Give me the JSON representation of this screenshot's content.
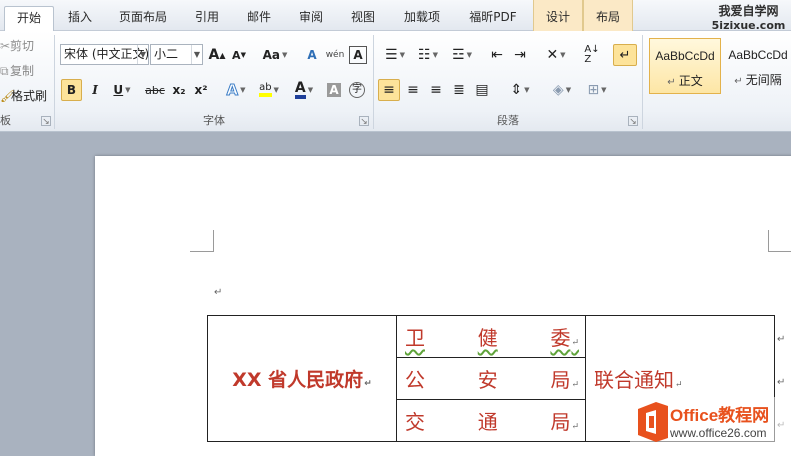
{
  "tabs": [
    "开始",
    "插入",
    "页面布局",
    "引用",
    "邮件",
    "审阅",
    "视图",
    "加载项",
    "福昕PDF",
    "设计",
    "布局"
  ],
  "active_tab": "开始",
  "brand": {
    "line1": "我爱自学网",
    "line2": "5izixue.com"
  },
  "clipboard": {
    "cut": "剪切",
    "copy": "复制",
    "format_painter": "格式刷",
    "label": "板"
  },
  "font": {
    "name": "宋体 (中文正文)",
    "size": "小二",
    "label": "字体",
    "grow_label": "A",
    "shrink_label": "A",
    "case_label": "Aa",
    "wen_label": "wén",
    "bold": "B",
    "italic": "I",
    "underline": "U",
    "strike": "abc",
    "sub": "x₂",
    "sup": "x²",
    "text_effect": "A",
    "highlight": "ab",
    "font_color": "A",
    "char_shade": "A",
    "enclose": "字",
    "clear_label": "A"
  },
  "paragraph": {
    "label": "段落"
  },
  "styles": [
    {
      "sample": "AaBbCcDd",
      "name": "正文",
      "selected": true
    },
    {
      "sample": "AaBbCcDd",
      "name": "无间隔",
      "selected": false
    }
  ],
  "document": {
    "pilcrow": "↵",
    "table": {
      "left": "XX 省人民政府",
      "middle": [
        {
          "chars": [
            "卫",
            "健",
            "委"
          ]
        },
        {
          "chars": [
            "公",
            "安",
            "局"
          ]
        },
        {
          "chars": [
            "交",
            "通",
            "局"
          ]
        }
      ],
      "right": "联合通知"
    }
  },
  "logo": {
    "brand": "Office教程网",
    "url": "www.office26.com"
  },
  "colors": {
    "accent_red": "#c0392b",
    "logo_orange": "#e8511d"
  }
}
